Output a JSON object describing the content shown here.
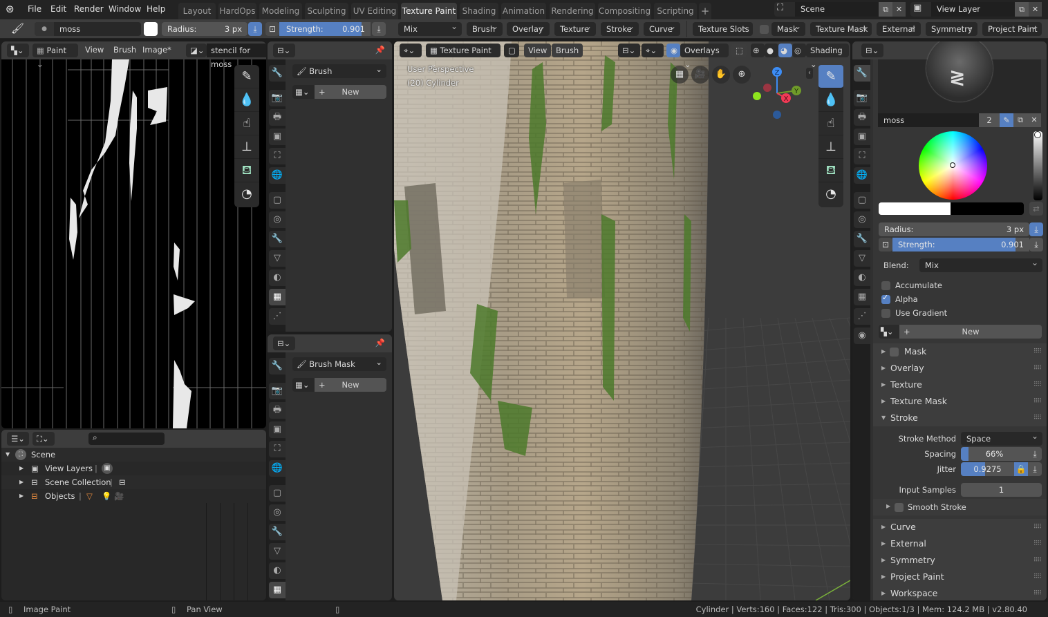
{
  "topbar": {
    "menus": [
      "File",
      "Edit",
      "Render",
      "Window",
      "Help"
    ],
    "workspaces": [
      "Layout",
      "HardOps",
      "Modeling",
      "Sculpting",
      "UV Editing",
      "Texture Paint",
      "Shading",
      "Animation",
      "Rendering",
      "Compositing",
      "Scripting"
    ],
    "active_workspace": "Texture Paint",
    "add_workspace": "+",
    "scene": "Scene",
    "view_layer": "View Layer"
  },
  "toolheader": {
    "brush_name": "moss",
    "radius_label": "Radius:",
    "radius_value": "3 px",
    "strength_label": "Strength:",
    "strength_value": "0.901",
    "strength_fraction": 0.901,
    "blend": "Mix",
    "popovers": [
      "Brush",
      "Overlay",
      "Texture",
      "Stroke",
      "Curve"
    ],
    "popovers2": [
      "Texture Slots",
      "Mask",
      "Texture Mask",
      "External",
      "Symmetry",
      "Project Paint"
    ],
    "accent_color": "#5680c2"
  },
  "image_editor": {
    "mode": "Paint",
    "menus": [
      "View",
      "Brush",
      "Image*"
    ],
    "image_name": "stencil for moss"
  },
  "texture_props_top": {
    "texture_slot": "Brush",
    "new_label": "New"
  },
  "texture_props_bottom": {
    "texture_slot": "Brush Mask",
    "new_label": "New"
  },
  "viewport": {
    "mode": "Texture Paint",
    "menus": [
      "View",
      "Brush"
    ],
    "overlays_label": "Overlays",
    "shading_label": "Shading",
    "perspective": "User Perspective",
    "object_info": "(20) Cylinder",
    "gizmo": {
      "z": "Z",
      "y": "Y",
      "x": "X"
    }
  },
  "outliner": {
    "rows": [
      {
        "label": "Scene",
        "level": 0,
        "expanded": true
      },
      {
        "label": "View Layers",
        "level": 1
      },
      {
        "label": "Scene Collection",
        "level": 1
      },
      {
        "label": "Objects",
        "level": 1
      }
    ]
  },
  "properties": {
    "brush_name": "moss",
    "brush_users": "2",
    "radius_label": "Radius:",
    "radius_value": "3 px",
    "strength_label": "Strength:",
    "strength_value": "0.901",
    "strength_fraction": 0.901,
    "blend_label": "Blend:",
    "blend_value": "Mix",
    "checkboxes": [
      {
        "label": "Accumulate",
        "checked": false
      },
      {
        "label": "Alpha",
        "checked": true
      },
      {
        "label": "Use Gradient",
        "checked": false
      }
    ],
    "new_label": "New",
    "panels_before": [
      "Mask",
      "Overlay",
      "Texture",
      "Texture Mask"
    ],
    "stroke_panel": "Stroke",
    "stroke_method_label": "Stroke Method",
    "stroke_method_value": "Space",
    "spacing_label": "Spacing",
    "spacing_value": "66%",
    "spacing_fraction": 0.11,
    "jitter_label": "Jitter",
    "jitter_value": "0.9275",
    "jitter_fraction": 0.45,
    "input_samples_label": "Input Samples",
    "input_samples_value": "1",
    "smooth_stroke_label": "Smooth Stroke",
    "panels_after": [
      "Curve",
      "External",
      "Symmetry",
      "Project Paint",
      "Workspace"
    ]
  },
  "statusbar": {
    "left_action": "Image Paint",
    "middle_action": "Pan View",
    "stats": "Cylinder | Verts:160 | Faces:122 | Tris:300 | Objects:1/3 | Mem: 124.2 MB | v2.80.40"
  }
}
